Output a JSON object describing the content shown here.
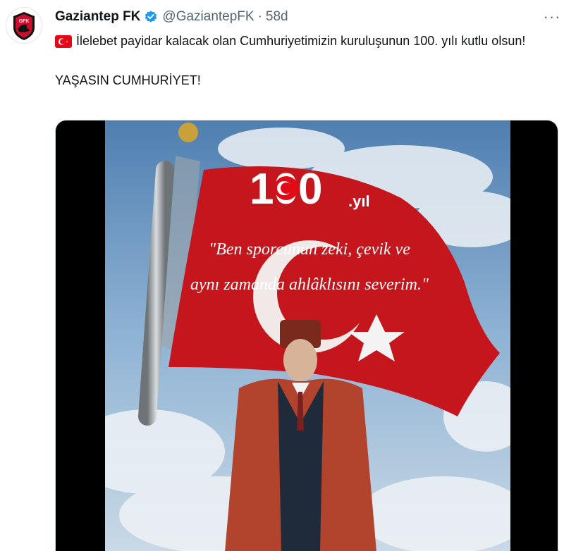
{
  "tweet": {
    "author_name": "Gaziantep FK",
    "handle": "@GaziantepFK",
    "separator": "·",
    "time": "58d",
    "more_label": "···",
    "avatar_text": "GFK",
    "text_line1": "İlelebet payidar kalacak olan Cumhuriyetimizin kuruluşunun 100. yılı kutlu olsun!",
    "text_line2": "YAŞASIN CUMHURİYET!",
    "flag_icon": "turkey-flag-icon",
    "verified_icon": "verified-badge-icon"
  },
  "media": {
    "number": "100",
    "suffix": ".yıl",
    "quote_line1": "\"Ben sporcunun zeki, çevik ve",
    "quote_line2": "aynı zamanda ahlâklısını severim.\""
  },
  "colors": {
    "verified": "#1d9bf0",
    "flag_red": "#e30a17",
    "muted": "#536471"
  }
}
